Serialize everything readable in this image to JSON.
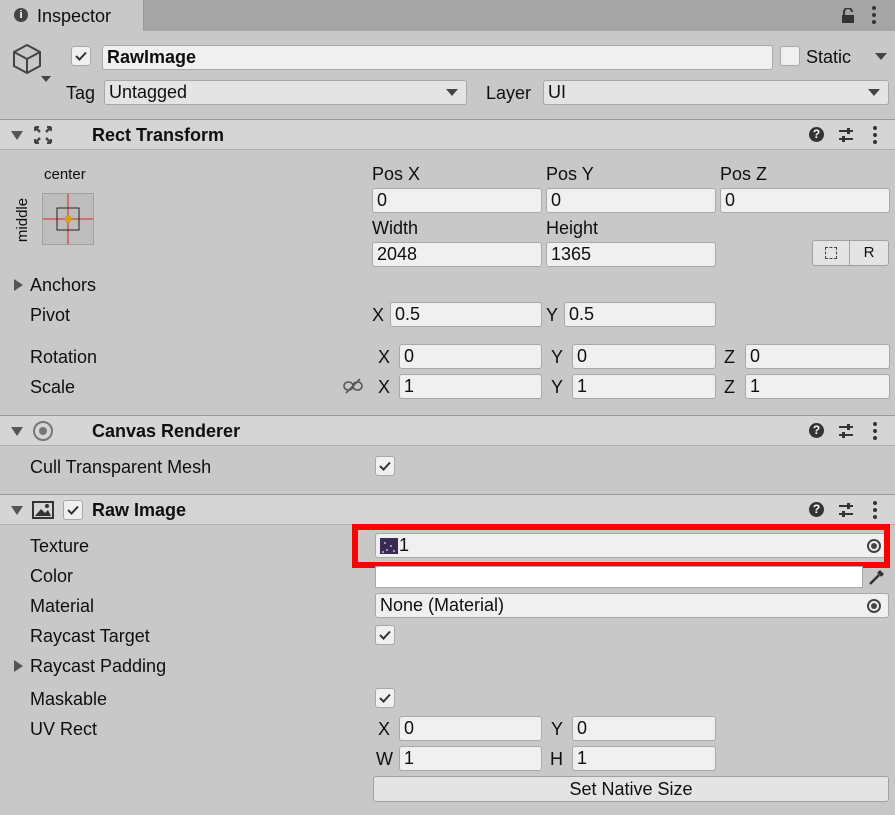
{
  "tab": {
    "title": "Inspector"
  },
  "object": {
    "name": "RawImage",
    "active": true,
    "static_label": "Static",
    "static_checked": false,
    "tag_label": "Tag",
    "tag_value": "Untagged",
    "layer_label": "Layer",
    "layer_value": "UI"
  },
  "rect_transform": {
    "title": "Rect Transform",
    "anchor_h": "center",
    "anchor_v": "middle",
    "pos_x_label": "Pos X",
    "pos_x": "0",
    "pos_y_label": "Pos Y",
    "pos_y": "0",
    "pos_z_label": "Pos Z",
    "pos_z": "0",
    "width_label": "Width",
    "width": "2048",
    "height_label": "Height",
    "height": "1365",
    "r_button": "R",
    "anchors_label": "Anchors",
    "pivot_label": "Pivot",
    "pivot_x_label": "X",
    "pivot_x": "0.5",
    "pivot_y_label": "Y",
    "pivot_y": "0.5",
    "rotation_label": "Rotation",
    "rot_x_label": "X",
    "rot_x": "0",
    "rot_y_label": "Y",
    "rot_y": "0",
    "rot_z_label": "Z",
    "rot_z": "0",
    "scale_label": "Scale",
    "scale_x_label": "X",
    "scale_x": "1",
    "scale_y_label": "Y",
    "scale_y": "1",
    "scale_z_label": "Z",
    "scale_z": "1"
  },
  "canvas_renderer": {
    "title": "Canvas Renderer",
    "cull_label": "Cull Transparent Mesh",
    "cull_checked": true
  },
  "raw_image": {
    "title": "Raw Image",
    "enabled": true,
    "texture_label": "Texture",
    "texture_value": "1",
    "color_label": "Color",
    "color_value": "#ffffff",
    "material_label": "Material",
    "material_value": "None (Material)",
    "raycast_target_label": "Raycast Target",
    "raycast_target_checked": true,
    "raycast_padding_label": "Raycast Padding",
    "maskable_label": "Maskable",
    "maskable_checked": true,
    "uv_rect_label": "UV Rect",
    "uv_x_label": "X",
    "uv_x": "0",
    "uv_y_label": "Y",
    "uv_y": "0",
    "uv_w_label": "W",
    "uv_w": "1",
    "uv_h_label": "H",
    "uv_h": "1",
    "native_size_button": "Set Native Size"
  },
  "colors": {
    "highlight": "#ff0000",
    "background": "#c8c8c8"
  }
}
